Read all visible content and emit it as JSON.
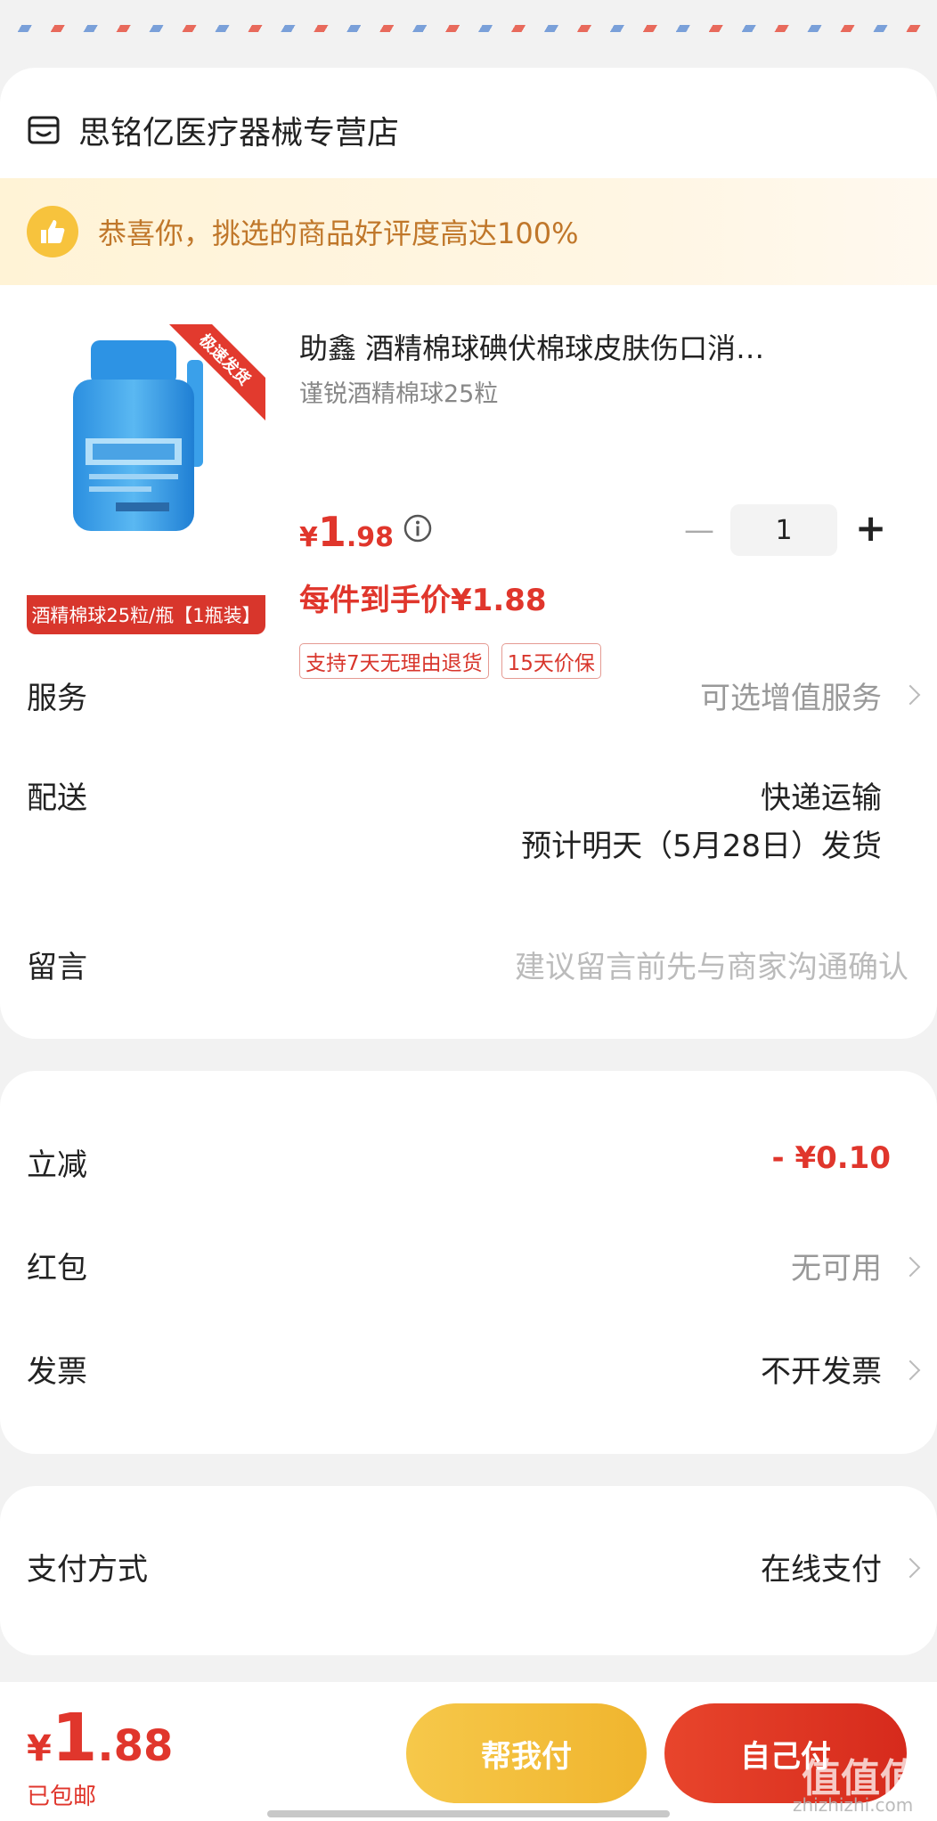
{
  "store": {
    "name": "思铭亿医疗器械专营店",
    "icon": "store-icon"
  },
  "praise": {
    "text": "恭喜你，挑选的商品好评度高达100%",
    "icon": "thumbs-up-icon"
  },
  "product": {
    "ribbon": "极速发货",
    "image_banner": "酒精棉球25粒/瓶【1瓶装】",
    "title": "助鑫 酒精棉球碘伏棉球皮肤伤口消…",
    "spec": "谨锐酒精棉球25粒",
    "price_currency": "¥",
    "price_int": "1",
    "price_dec": ".98",
    "quantity": "1",
    "final_price": "每件到手价¥1.88",
    "tags": [
      "支持7天无理由退货",
      "15天价保"
    ]
  },
  "service": {
    "label": "服务",
    "value": "可选增值服务"
  },
  "delivery": {
    "label": "配送",
    "method": "快递运输",
    "eta": "预计明天（5月28日）发货"
  },
  "message": {
    "label": "留言",
    "placeholder": "建议留言前先与商家沟通确认"
  },
  "discount": {
    "label": "立减",
    "value": "- ¥0.10"
  },
  "red_packet": {
    "label": "红包",
    "value": "无可用"
  },
  "invoice": {
    "label": "发票",
    "value": "不开发票"
  },
  "payment": {
    "label": "支付方式",
    "value": "在线支付"
  },
  "footer": {
    "total_currency": "¥",
    "total_int": "1",
    "total_dec": ".88",
    "shipping_note": "已包邮",
    "help_pay_label": "帮我付",
    "self_pay_label": "自己付"
  },
  "watermark": {
    "text": "值值值",
    "sub": "zhizhizhi.com"
  },
  "colors": {
    "accent_red": "#e0362c",
    "praise_text": "#c0772a",
    "help_button": "#f0b52e",
    "self_button": "#d62a1c"
  }
}
